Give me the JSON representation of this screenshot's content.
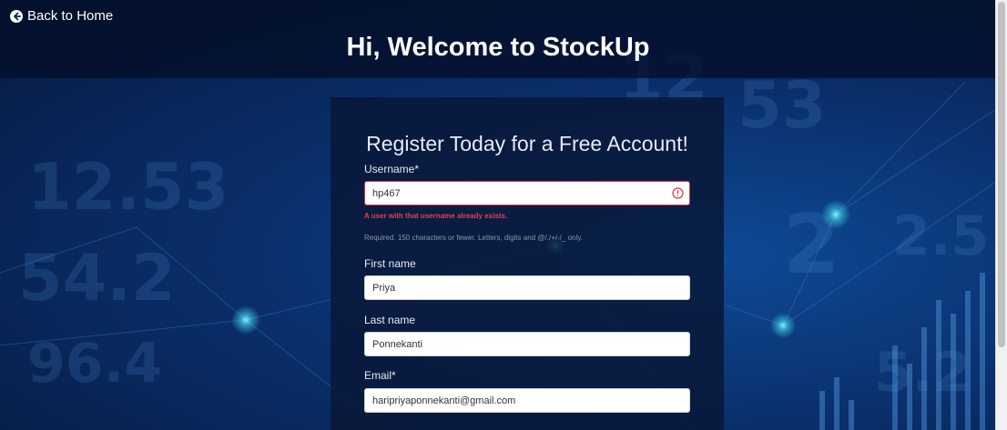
{
  "nav": {
    "back_label": "Back to Home"
  },
  "page": {
    "title": "Hi, Welcome to StockUp"
  },
  "form": {
    "heading": "Register Today for a Free Account!",
    "username": {
      "label": "Username*",
      "value": "hp467",
      "error": "A user with that username already exists.",
      "help": "Required. 150 characters or fewer. Letters, digits and @/./+/-/_ only."
    },
    "first_name": {
      "label": "First name",
      "value": "Priya"
    },
    "last_name": {
      "label": "Last name",
      "value": "Ponnekanti"
    },
    "email": {
      "label": "Email*",
      "value": "haripriyaponnekanti@gmail.com"
    }
  },
  "colors": {
    "error": "#dc3545",
    "background": "#0a2f6c"
  }
}
